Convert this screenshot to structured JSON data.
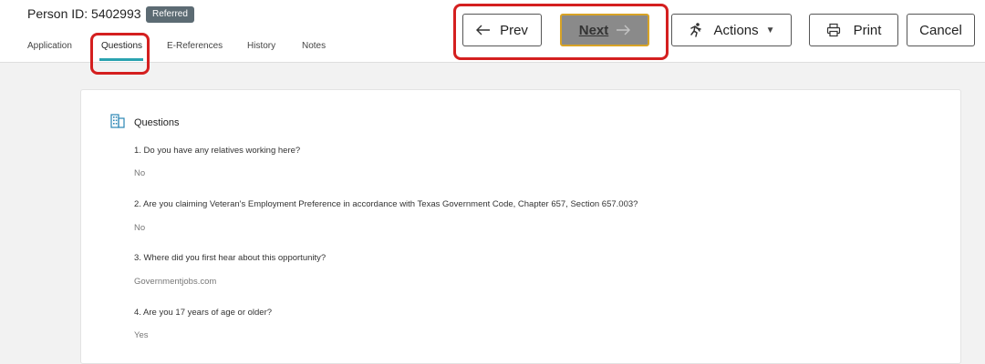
{
  "header": {
    "person_id": "Person ID: 5402993",
    "status_badge": "Referred"
  },
  "tabs": [
    {
      "label": "Application"
    },
    {
      "label": "Questions",
      "active": true
    },
    {
      "label": "E-References"
    },
    {
      "label": "History"
    },
    {
      "label": "Notes"
    }
  ],
  "toolbar": {
    "prev_label": "Prev",
    "next_label": "Next",
    "actions_label": "Actions",
    "print_label": "Print",
    "cancel_label": "Cancel"
  },
  "section": {
    "title": "Questions",
    "questions": [
      {
        "q": "1. Do you have any relatives working here?",
        "a": "No"
      },
      {
        "q": "2. Are you claiming Veteran's Employment Preference in accordance with Texas Government Code, Chapter 657, Section 657.003?",
        "a": "No"
      },
      {
        "q": "3. Where did you first hear about this opportunity?",
        "a": "Governmentjobs.com"
      },
      {
        "q": "4. Are you 17 years of age or older?",
        "a": "Yes"
      }
    ]
  },
  "colors": {
    "accent_tab": "#2aa3b0",
    "highlight_red": "#d41f1f",
    "next_bg": "#8a8a8a",
    "next_border": "#d8a326",
    "badge_bg": "#5c6b73"
  }
}
